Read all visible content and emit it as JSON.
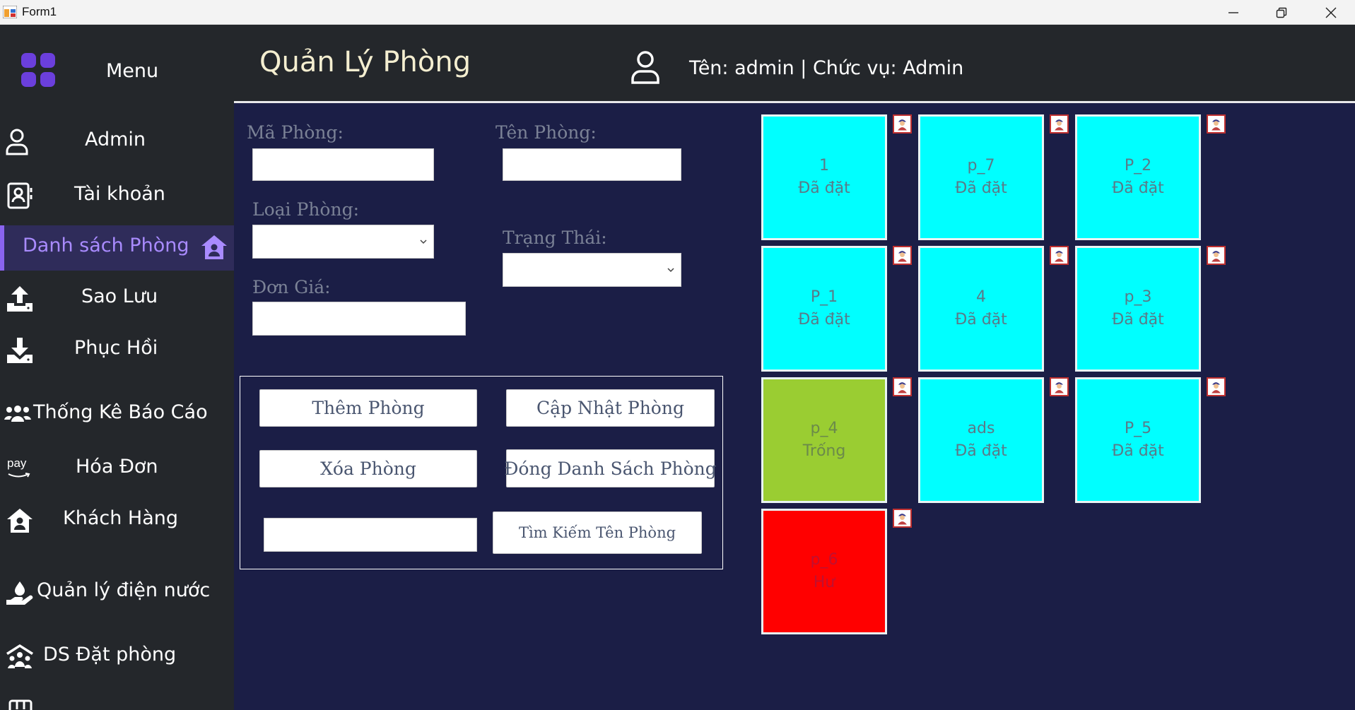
{
  "window": {
    "title": "Form1",
    "minimize": "minimize",
    "maximize": "restore",
    "close": "close"
  },
  "sidebar": {
    "menu_label": "Menu",
    "items": [
      {
        "label": "Admin",
        "icon": "user-icon"
      },
      {
        "label": "Tài khoản",
        "icon": "contact-card-icon"
      },
      {
        "label": "Danh sách Phòng",
        "icon": "house-user-icon",
        "active": true
      },
      {
        "label": "Sao Lưu",
        "icon": "upload-icon"
      },
      {
        "label": "Phục Hồi",
        "icon": "download-icon"
      },
      {
        "label": "Thống Kê Báo Cáo",
        "icon": "users-group-icon"
      },
      {
        "label": "Hóa Đơn",
        "icon": "pay-icon",
        "icon_text": "pay"
      },
      {
        "label": "Khách Hàng",
        "icon": "house-user-icon"
      },
      {
        "label": "Quản lý điện nước",
        "icon": "hand-drop-icon"
      },
      {
        "label": "DS Đặt phòng",
        "icon": "people-roof-icon"
      }
    ],
    "active_color": "#a98bff"
  },
  "header": {
    "title": "Quản Lý Phòng",
    "user_info": "Tên: admin | Chức vụ: Admin"
  },
  "form": {
    "ma_phong_label": "Mã Phòng:",
    "ten_phong_label": "Tên Phòng:",
    "loai_phong_label": "Loại Phòng:",
    "trang_thai_label": "Trạng Thái:",
    "don_gia_label": "Đơn Giá:",
    "ma_phong_value": "",
    "ten_phong_value": "",
    "loai_phong_value": "",
    "trang_thai_value": "",
    "don_gia_value": "",
    "search_value": ""
  },
  "buttons": {
    "add": "Thêm Phòng",
    "update": "Cập Nhật Phòng",
    "delete": "Xóa Phòng",
    "close_list": "Đóng Danh Sách Phòng",
    "search": "Tìm Kiếm Tên Phòng"
  },
  "rooms": [
    {
      "name": "1",
      "status": "Đã đặt",
      "state": "booked"
    },
    {
      "name": "p_7",
      "status": "Đã đặt",
      "state": "booked"
    },
    {
      "name": "P_2",
      "status": "Đã đặt",
      "state": "booked"
    },
    {
      "name": "P_1",
      "status": "Đã đặt",
      "state": "booked"
    },
    {
      "name": "4",
      "status": "Đã đặt",
      "state": "booked"
    },
    {
      "name": "p_3",
      "status": "Đã đặt",
      "state": "booked"
    },
    {
      "name": "p_4",
      "status": "Trống",
      "state": "empty"
    },
    {
      "name": "ads",
      "status": "Đã đặt",
      "state": "booked"
    },
    {
      "name": "P_5",
      "status": "Đã đặt",
      "state": "booked"
    },
    {
      "name": "p_6",
      "status": "Hư",
      "state": "broken"
    }
  ],
  "colors": {
    "booked": "#00ffff",
    "empty": "#9acd32",
    "broken": "#ff0000",
    "content_bg": "#1b1e46",
    "sidebar_bg": "#24272b"
  }
}
